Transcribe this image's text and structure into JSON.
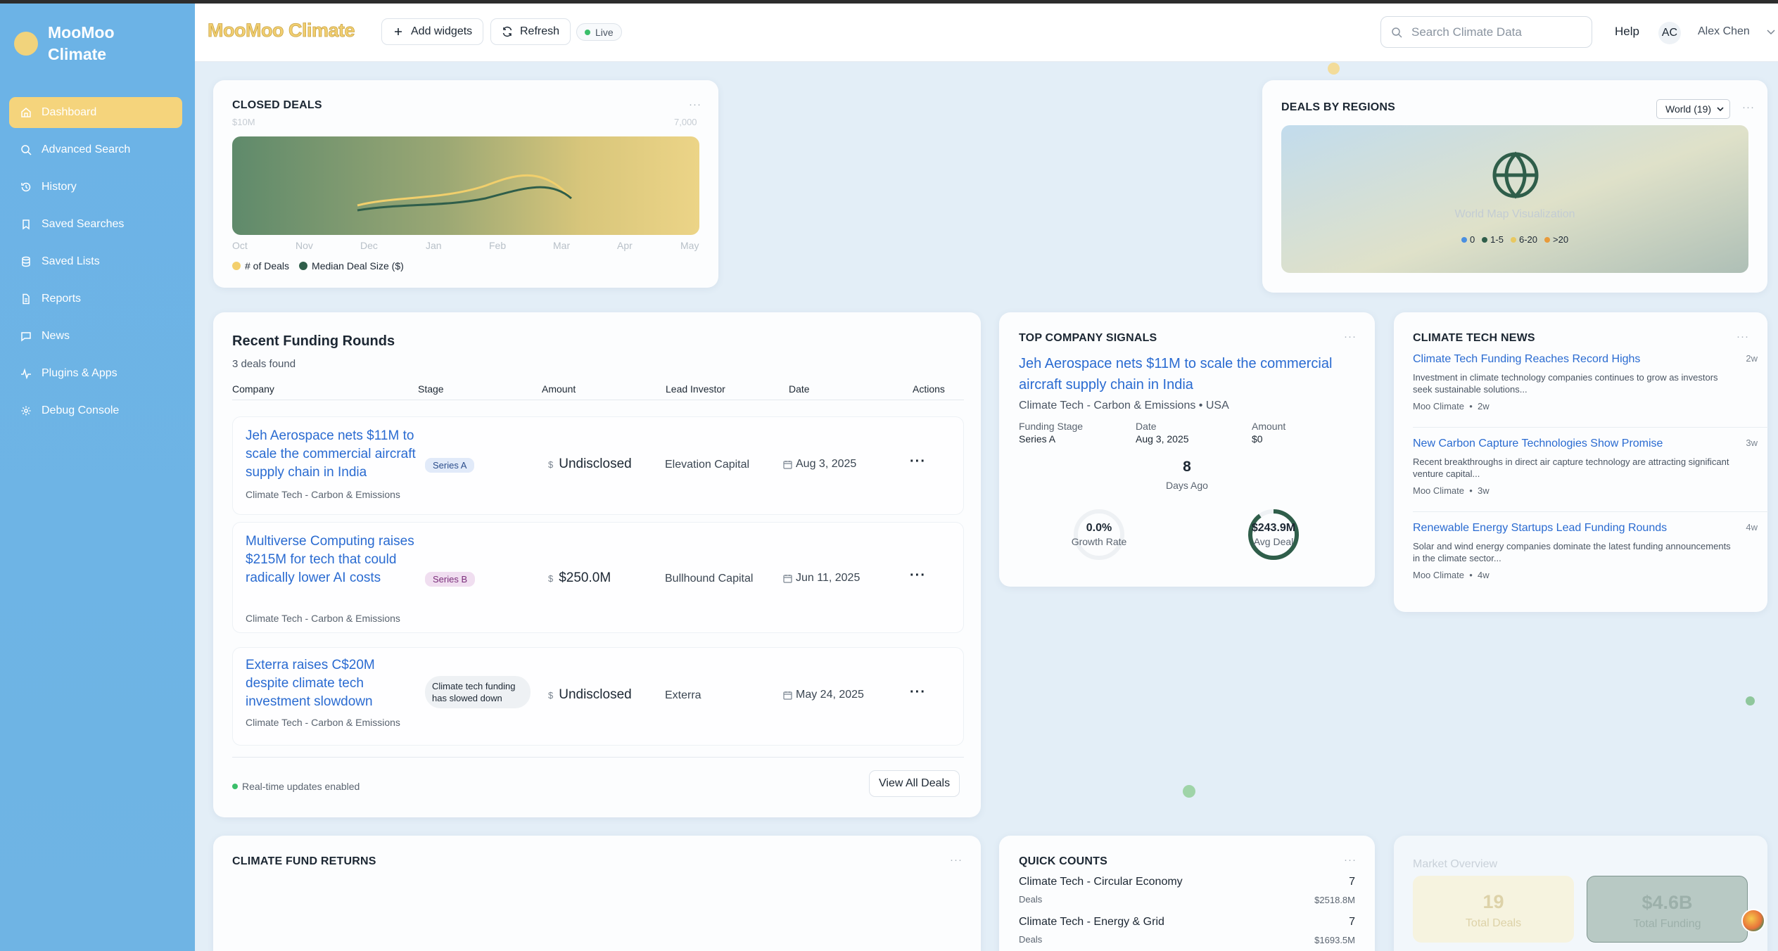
{
  "brand": {
    "line1": "MooMoo",
    "line2": "Climate"
  },
  "sidebar": {
    "items": [
      {
        "label": "Dashboard",
        "icon": "home-icon",
        "active": true
      },
      {
        "label": "Advanced Search",
        "icon": "search-icon"
      },
      {
        "label": "History",
        "icon": "history-icon"
      },
      {
        "label": "Saved Searches",
        "icon": "bookmark-icon"
      },
      {
        "label": "Saved Lists",
        "icon": "database-icon"
      },
      {
        "label": "Reports",
        "icon": "file-icon"
      },
      {
        "label": "News",
        "icon": "message-icon"
      },
      {
        "label": "Plugins & Apps",
        "icon": "activity-icon"
      },
      {
        "label": "Debug Console",
        "icon": "gear-icon"
      }
    ]
  },
  "header": {
    "title": "MooMoo Climate",
    "add_widgets": "Add widgets",
    "refresh": "Refresh",
    "live": "Live",
    "search_placeholder": "Search Climate Data",
    "help": "Help",
    "avatar_initials": "AC",
    "user_name": "Alex Chen"
  },
  "closed_deals": {
    "title": "CLOSED DEALS",
    "menu": "···",
    "left_axis": "$10M",
    "right_axis": "7,000",
    "months": [
      "Oct",
      "Nov",
      "Dec",
      "Jan",
      "Feb",
      "Mar",
      "Apr",
      "May"
    ],
    "legend": [
      {
        "label": "# of Deals",
        "color": "#f3cf6c"
      },
      {
        "label": "Median Deal Size ($)",
        "color": "#2f5e4a"
      }
    ]
  },
  "regions": {
    "title": "DEALS BY REGIONS",
    "select_value": "World (19)",
    "menu": "···",
    "caption": "World Map Visualization",
    "legend": [
      {
        "label": "0",
        "color": "#4a8fe0"
      },
      {
        "label": "1-5",
        "color": "#2f5e4a"
      },
      {
        "label": "6-20",
        "color": "#e8c861"
      },
      {
        "label": ">20",
        "color": "#e89a3a"
      }
    ]
  },
  "funding": {
    "title": "Recent Funding Rounds",
    "subtitle": "3 deals found",
    "columns": [
      "Company",
      "Stage",
      "Amount",
      "Lead Investor",
      "Date",
      "Actions"
    ],
    "rows": [
      {
        "title": "Jeh Aerospace nets $11M to scale the commercial aircraft supply chain in India",
        "category": "Climate Tech - Carbon & Emissions",
        "stage": "Series A",
        "amount": "Undisclosed",
        "investor": "Elevation Capital",
        "date": "Aug 3, 2025"
      },
      {
        "title": "Multiverse Computing raises $215M for tech that could radically lower AI costs",
        "category": "Climate Tech - Carbon & Emissions",
        "stage": "Series B",
        "amount": "$250.0M",
        "investor": "Bullhound Capital",
        "date": "Jun 11, 2025"
      },
      {
        "title": "Exterra raises C$20M despite climate tech investment slowdown",
        "category": "Climate Tech - Carbon & Emissions",
        "stage": "Climate tech funding has slowed down",
        "amount": "Undisclosed",
        "investor": "Exterra",
        "date": "May 24, 2025"
      }
    ],
    "currency_sign": "$",
    "actions_label": "···",
    "realtime": "Real-time updates enabled",
    "view_all": "View All Deals"
  },
  "signals": {
    "title": "TOP COMPANY SIGNALS",
    "menu": "···",
    "headline": "Jeh Aerospace nets $11M to scale the commercial aircraft supply chain in India",
    "meta": "Climate Tech - Carbon & Emissions • USA",
    "fields": [
      {
        "k": "Funding Stage",
        "v": "Series A"
      },
      {
        "k": "Date",
        "v": "Aug 3, 2025"
      },
      {
        "k": "Amount",
        "v": "$0"
      }
    ],
    "days_value": "8",
    "days_label": "Days Ago",
    "growth_value": "0.0%",
    "growth_label": "Growth Rate",
    "growth_fraction": 0,
    "avg_value": "$243.9M",
    "avg_label": "Avg Deal",
    "avg_fraction": 0.9
  },
  "news": {
    "title": "CLIMATE TECH NEWS",
    "menu": "···",
    "items": [
      {
        "title": "Climate Tech Funding Reaches Record Highs",
        "age": "2w",
        "body": "Investment in climate technology companies continues to grow as investors seek sustainable solutions...",
        "source": "Moo Climate",
        "source_age": "2w"
      },
      {
        "title": "New Carbon Capture Technologies Show Promise",
        "age": "3w",
        "body": "Recent breakthroughs in direct air capture technology are attracting significant venture capital...",
        "source": "Moo Climate",
        "source_age": "3w"
      },
      {
        "title": "Renewable Energy Startups Lead Funding Rounds",
        "age": "4w",
        "body": "Solar and wind energy companies dominate the latest funding announcements in the climate sector...",
        "source": "Moo Climate",
        "source_age": "4w"
      }
    ]
  },
  "fund_returns": {
    "title": "CLIMATE FUND RETURNS",
    "menu": "···"
  },
  "quick_counts": {
    "title": "QUICK COUNTS",
    "menu": "···",
    "rows": [
      {
        "name": "Climate Tech - Circular Economy",
        "count": "7",
        "sub": "Deals",
        "amount": "$2518.8M"
      },
      {
        "name": "Climate Tech - Energy & Grid",
        "count": "7",
        "sub": "Deals",
        "amount": "$1693.5M"
      }
    ]
  },
  "market_overview": {
    "title": "Market Overview",
    "boxes": [
      {
        "value": "19",
        "label": "Total Deals"
      },
      {
        "value": "$4.6B",
        "label": "Total Funding"
      }
    ]
  }
}
